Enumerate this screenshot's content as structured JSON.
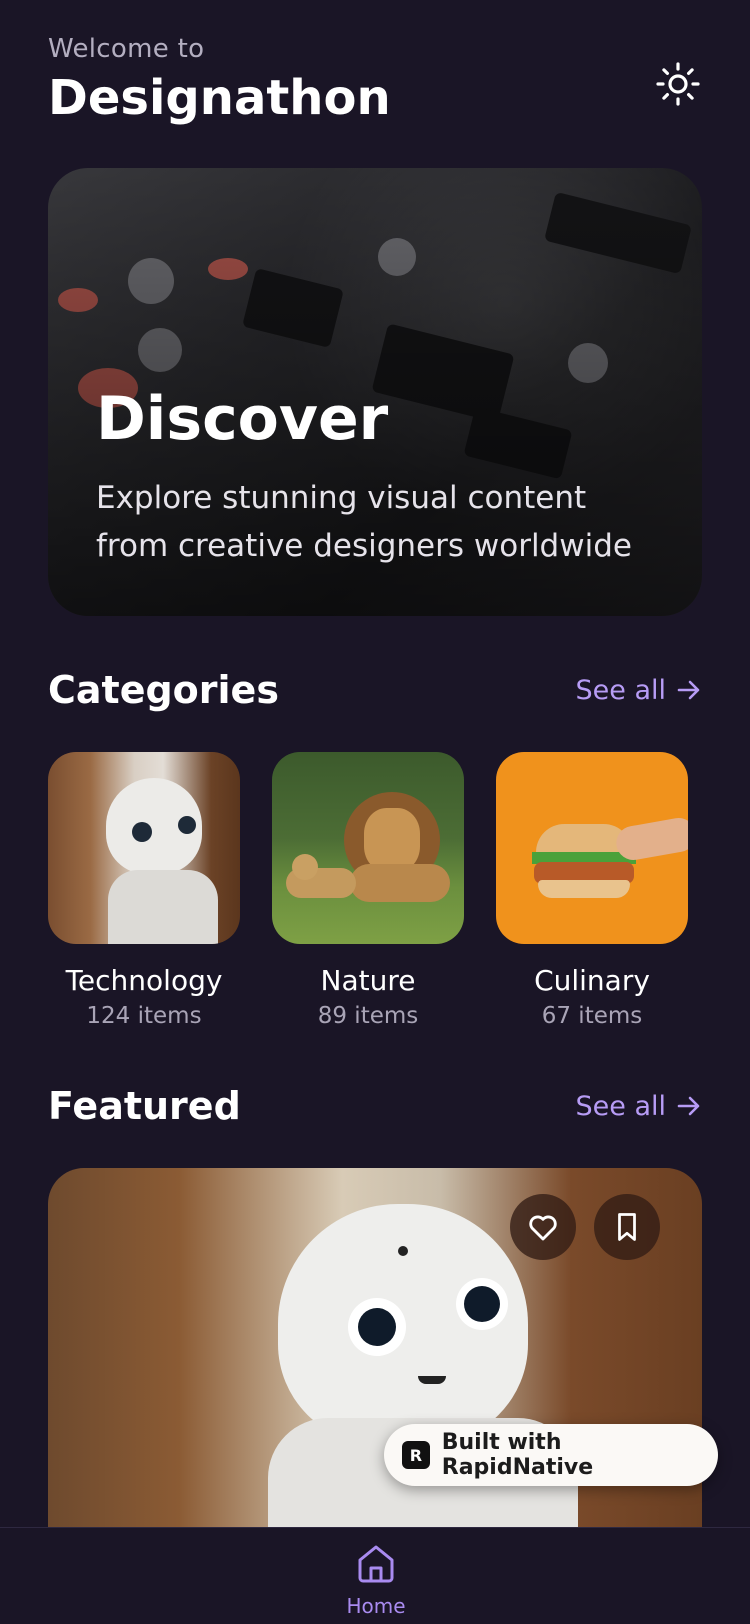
{
  "header": {
    "welcome": "Welcome to",
    "title": "Designathon",
    "theme_icon": "sun-icon"
  },
  "hero": {
    "title": "Discover",
    "subtitle": "Explore stunning visual content from creative designers worldwide"
  },
  "categories": {
    "title": "Categories",
    "see_all": "See all",
    "items": [
      {
        "name": "Technology",
        "count": "124 items"
      },
      {
        "name": "Nature",
        "count": "89 items"
      },
      {
        "name": "Culinary",
        "count": "67 items"
      }
    ]
  },
  "featured": {
    "title": "Featured",
    "see_all": "See all",
    "icons": [
      "heart-icon",
      "bookmark-icon"
    ]
  },
  "badge": {
    "label": "Built with RapidNative"
  },
  "nav": {
    "items": [
      {
        "label": "Home",
        "icon": "home-icon"
      }
    ]
  },
  "colors": {
    "background": "#1a1526",
    "accent": "#b79cf5",
    "muted_text": "#a9a4b6"
  }
}
